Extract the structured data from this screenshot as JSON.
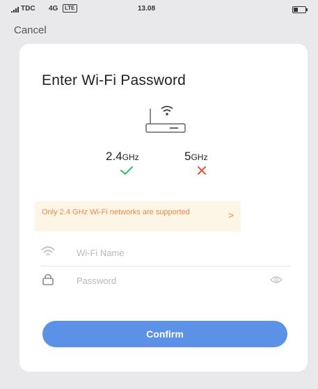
{
  "status_bar": {
    "carrier": "TDC",
    "network": "4G",
    "lte_badge": "LTE",
    "time": "13.08",
    "battery_level": 0.4
  },
  "nav": {
    "cancel_label": "Cancel"
  },
  "card": {
    "title": "Enter Wi-Fi Password",
    "illustration_icon": "router-wifi-icon",
    "bands": [
      {
        "value": "2.4",
        "unit": "GHz",
        "status": "supported",
        "status_icon": "check-icon",
        "status_color": "#3bbf6a"
      },
      {
        "value": "5",
        "unit": "GHz",
        "status": "unsupported",
        "status_icon": "cross-icon",
        "status_color": "#e5533d"
      }
    ],
    "notice": {
      "text": "Only 2.4 GHz Wi-Fi networks are supported",
      "arrow": ">",
      "color": "#e9884a",
      "background": "#fdf6e6"
    },
    "wifi_name": {
      "placeholder": "Wi-Fi Name",
      "value": "",
      "icon": "wifi-icon"
    },
    "password": {
      "placeholder": "Password",
      "value": "",
      "icon": "lock-icon",
      "toggle_icon": "eye-icon"
    },
    "confirm_label": "Confirm",
    "accent_color": "#5b92e8"
  }
}
